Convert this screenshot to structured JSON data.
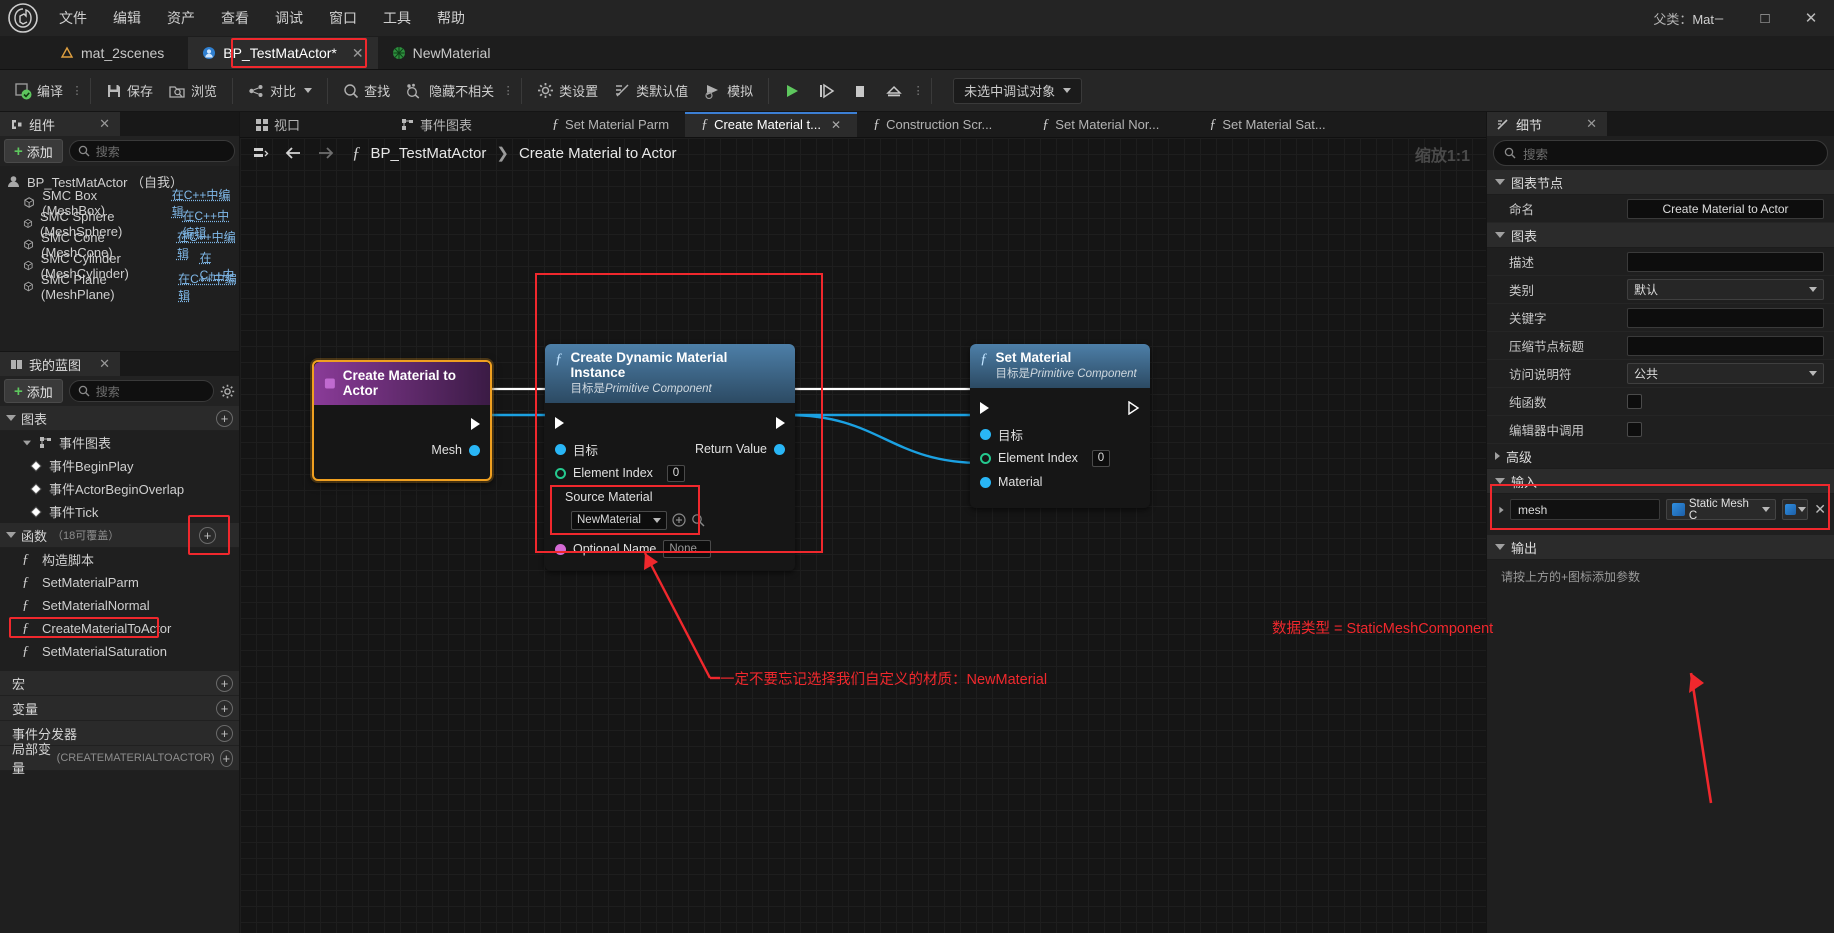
{
  "menu": {
    "items": [
      "文件",
      "编辑",
      "资产",
      "查看",
      "调试",
      "窗口",
      "工具",
      "帮助"
    ],
    "parent_class_label": "父类：",
    "parent_class_value": "Mat"
  },
  "asset_tabs": [
    {
      "label": "mat_2scenes",
      "icon": "level-icon",
      "active": false,
      "closable": false
    },
    {
      "label": "BP_TestMatActor*",
      "icon": "blueprint-icon",
      "active": true,
      "closable": true,
      "highlighted": true
    },
    {
      "label": "NewMaterial",
      "icon": "material-icon",
      "active": false,
      "closable": false
    }
  ],
  "toolbar": {
    "compile": "编译",
    "save": "保存",
    "browse": "浏览",
    "diff": "对比",
    "find": "查找",
    "hide_unrelated": "隐藏不相关",
    "class_settings": "类设置",
    "class_defaults": "类默认值",
    "simulate": "模拟",
    "debug_object": "未选中调试对象"
  },
  "components_panel": {
    "title": "组件",
    "add_label": "添加",
    "search_placeholder": "搜索",
    "root": "BP_TestMatActor （自我）",
    "items": [
      {
        "label": "SMC Box (MeshBox)",
        "link": "在C++中编辑"
      },
      {
        "label": "SMC Sphere (MeshSphere)",
        "link": "在C++中编辑"
      },
      {
        "label": "SMC Cone (MeshCone)",
        "link": "在C++中编辑"
      },
      {
        "label": "SMC Cylinder (MeshCylinder)",
        "link": "在C++中"
      },
      {
        "label": "SMC Plane (MeshPlane)",
        "link": "在C++中编辑"
      }
    ]
  },
  "myblueprint_panel": {
    "title": "我的蓝图",
    "add_label": "添加",
    "search_placeholder": "搜索",
    "sections": {
      "graphs": "图表",
      "event_graph": "事件图表",
      "functions": "函数",
      "functions_sub": "（18可覆盖）",
      "macros": "宏",
      "variables": "变量",
      "event_dispatchers": "事件分发器",
      "local_variables": "局部变量",
      "local_variables_sub": "(CREATEMATERIALTOACTOR)"
    },
    "events": [
      "事件BeginPlay",
      "事件ActorBeginOverlap",
      "事件Tick"
    ],
    "functions": [
      {
        "label": "构造脚本",
        "icon": "construction-script-icon",
        "selected": false
      },
      {
        "label": "SetMaterialParm",
        "icon": "function-icon",
        "selected": false
      },
      {
        "label": "SetMaterialNormal",
        "icon": "function-icon",
        "selected": false
      },
      {
        "label": "CreateMaterialToActor",
        "icon": "function-icon",
        "selected": true
      },
      {
        "label": "SetMaterialSaturation",
        "icon": "function-icon",
        "selected": false
      }
    ]
  },
  "graph_tabs": [
    {
      "label": "视口",
      "icon": "viewport-icon",
      "active": false,
      "closable": false
    },
    {
      "label": "事件图表",
      "icon": "eventgraph-icon",
      "active": false,
      "closable": false
    },
    {
      "label": "Set Material Parm",
      "icon": "function-icon",
      "active": false,
      "closable": false
    },
    {
      "label": "Create Material t...",
      "icon": "function-icon",
      "active": true,
      "closable": true
    },
    {
      "label": "Construction Scr...",
      "icon": "function-icon",
      "active": false,
      "closable": false
    },
    {
      "label": "Set Material Nor...",
      "icon": "function-icon",
      "active": false,
      "closable": false
    },
    {
      "label": "Set Material Sat...",
      "icon": "function-icon",
      "active": false,
      "closable": false
    }
  ],
  "breadcrumb": {
    "root": "BP_TestMatActor",
    "separator": "❯",
    "current": "Create Material to Actor",
    "zoom": "缩放1:1"
  },
  "graph_nodes": [
    {
      "id": "entry",
      "title": "Create Material to Actor",
      "subtitle": "",
      "pins_out": [
        {
          "label": "Mesh",
          "type": "object"
        }
      ]
    },
    {
      "id": "create_dynamic_material_instance",
      "title": "Create Dynamic Material Instance",
      "subtitle_prefix": "目标是",
      "subtitle_italic": "Primitive Component",
      "pins_in": [
        {
          "label": "目标",
          "type": "object"
        },
        {
          "label": "Element Index",
          "type": "int",
          "value": "0"
        },
        {
          "label": "Source Material",
          "type": "asset",
          "value": "NewMaterial"
        },
        {
          "label": "Optional Name",
          "type": "name",
          "value": "None"
        }
      ],
      "pins_out": [
        {
          "label": "Return Value",
          "type": "object"
        }
      ]
    },
    {
      "id": "set_material",
      "title": "Set Material",
      "subtitle_prefix": "目标是",
      "subtitle_italic": "Primitive Component",
      "pins_in": [
        {
          "label": "目标",
          "type": "object"
        },
        {
          "label": "Element Index",
          "type": "int",
          "value": "0"
        },
        {
          "label": "Material",
          "type": "object"
        }
      ]
    }
  ],
  "annotations": {
    "source_material_note": "一定不要忘记选择我们自定义的材质：NewMaterial",
    "datatype_note": "数据类型 = StaticMeshComponent",
    "accent_red": "#f0282d"
  },
  "details_panel": {
    "title": "细节",
    "search_placeholder": "搜索",
    "sections": {
      "graph_node": "图表节点",
      "graph": "图表",
      "advanced": "高级",
      "inputs": "输入",
      "outputs": "输出"
    },
    "rows": [
      {
        "label": "命名",
        "value": "Create Material to Actor",
        "kind": "text-center"
      },
      {
        "label": "描述",
        "value": "",
        "kind": "text"
      },
      {
        "label": "类别",
        "value": "默认",
        "kind": "combo"
      },
      {
        "label": "关键字",
        "value": "",
        "kind": "text"
      },
      {
        "label": "压缩节点标题",
        "value": "",
        "kind": "text"
      },
      {
        "label": "访问说明符",
        "value": "公共",
        "kind": "combo"
      },
      {
        "label": "纯函数",
        "value": "",
        "kind": "check"
      },
      {
        "label": "编辑器中调用",
        "value": "",
        "kind": "check"
      }
    ],
    "input_param": {
      "name": "mesh",
      "type": "Static Mesh C"
    },
    "output_note": "请按上方的+图标添加参数"
  }
}
